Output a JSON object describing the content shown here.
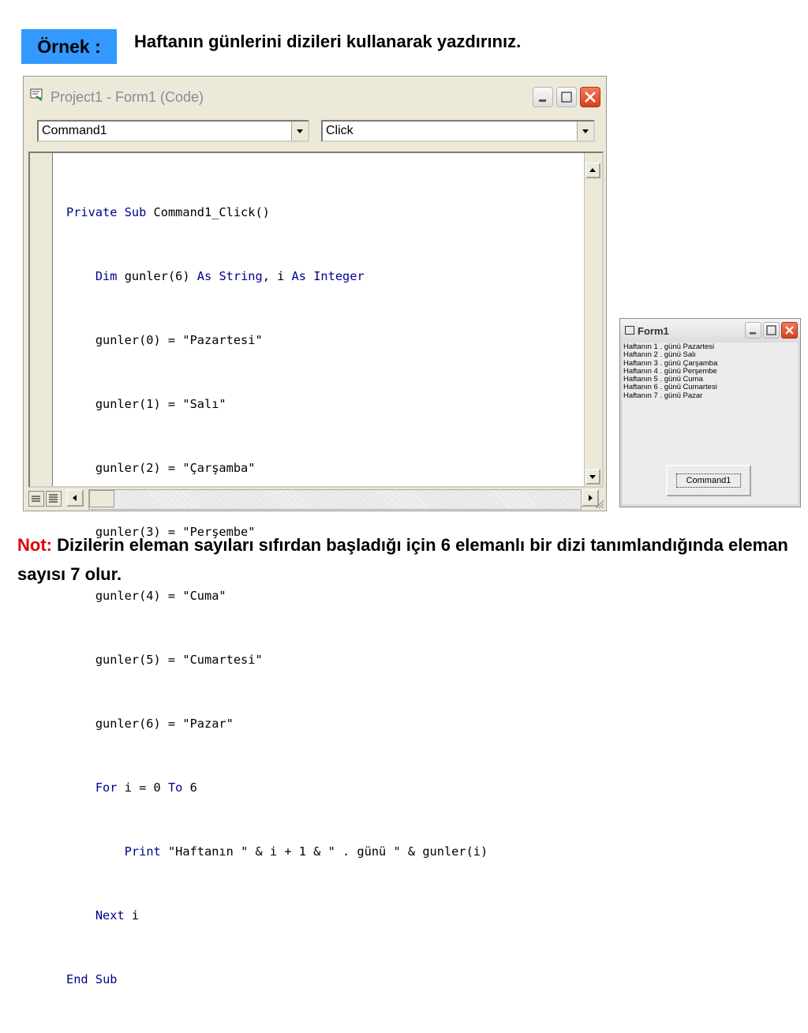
{
  "slide": {
    "badge": "Örnek :",
    "title": "Haftanın günlerini dizileri kullanarak yazdırınız.",
    "note_label": "Not:",
    "note_text": " Dizilerin eleman sayıları sıfırdan başladığı için 6 elemanlı bir dizi tanımlandığında eleman sayısı 7 olur."
  },
  "code_window": {
    "title": "Project1 - Form1 (Code)",
    "object_combo": "Command1",
    "procedure_combo": "Click",
    "code_lines": [
      "Private Sub Command1_Click()",
      "    Dim gunler(6) As String, i As Integer",
      "    gunler(0) = \"Pazartesi\"",
      "    gunler(1) = \"Salı\"",
      "    gunler(2) = \"Çarşamba\"",
      "    gunler(3) = \"Perşembe\"",
      "    gunler(4) = \"Cuma\"",
      "    gunler(5) = \"Cumartesi\"",
      "    gunler(6) = \"Pazar\"",
      "    For i = 0 To 6",
      "        Print \"Haftanın \" & i + 1 & \" . günü \" & gunler(i)",
      "    Next i",
      "End Sub"
    ],
    "icons": [
      "code-window-icon",
      "minimize-icon",
      "maximize-icon",
      "close-icon",
      "dropdown-arrow-icon",
      "scroll-up-icon",
      "scroll-down-icon",
      "scroll-left-icon",
      "scroll-right-icon",
      "procedure-view-icon",
      "full-module-view-icon",
      "resize-grip-icon"
    ]
  },
  "form_window": {
    "title": "Form1",
    "output_lines": [
      "Haftanın 1 . günü Pazartesi",
      "Haftanın 2 . günü Salı",
      "Haftanın 3 . günü Çarşamba",
      "Haftanın 4 . günü Perşembe",
      "Haftanın 5 . günü Cuma",
      "Haftanın 6 . günü Cumartesi",
      "Haftanın 7 . günü Pazar"
    ],
    "button_label": "Command1"
  }
}
